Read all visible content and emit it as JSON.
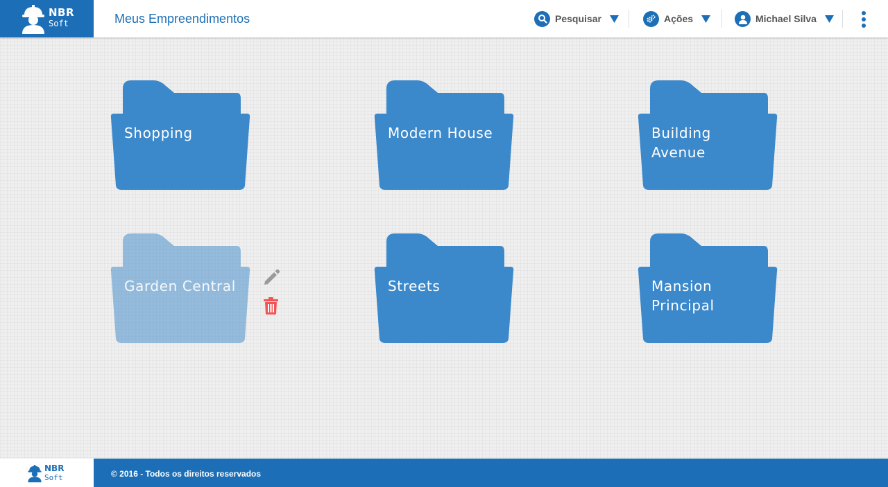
{
  "brand": {
    "line1": "NBR",
    "line2": "Soft"
  },
  "header": {
    "title": "Meus Empreendimentos",
    "search_label": "Pesquisar",
    "actions_label": "Ações",
    "user_name": "Michael Silva"
  },
  "folders": [
    {
      "name": "Shopping",
      "state": "normal"
    },
    {
      "name": "Modern House",
      "state": "normal"
    },
    {
      "name": "Building Avenue",
      "state": "normal"
    },
    {
      "name": "Garden Central",
      "state": "hover"
    },
    {
      "name": "Streets",
      "state": "normal"
    },
    {
      "name": "Mansion Principal",
      "state": "normal"
    }
  ],
  "footer": {
    "copyright": "© 2016 - Todos os direitos reservados"
  },
  "colors": {
    "primary": "#1c6fb6",
    "folder": "#3b88cb",
    "delete": "#f05454",
    "edit": "#9a9a9a"
  },
  "icons": [
    "worker-logo-icon",
    "search-icon",
    "gears-icon",
    "user-icon",
    "caret-down-icon",
    "kebab-menu-icon",
    "folder-icon",
    "pencil-icon",
    "trash-icon"
  ]
}
